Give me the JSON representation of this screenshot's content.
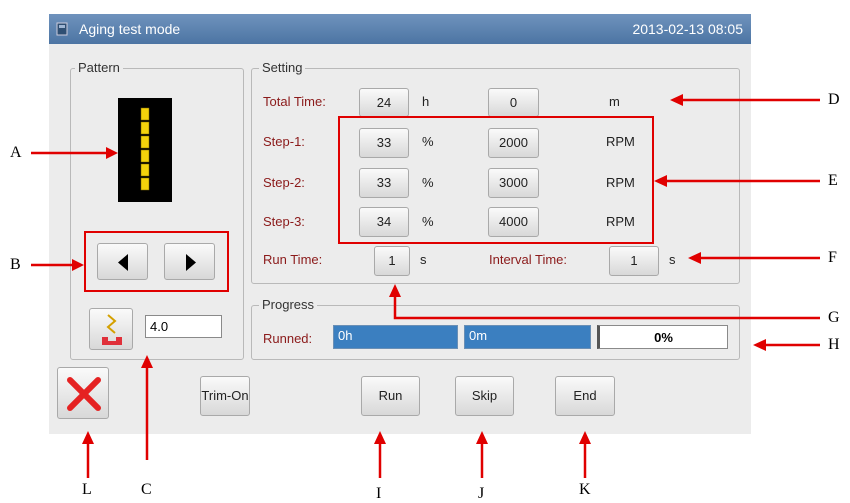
{
  "title_bar": {
    "title": "Aging test mode",
    "datetime": "2013-02-13  08:05"
  },
  "pattern": {
    "legend": "Pattern",
    "value": "4.0"
  },
  "setting": {
    "legend": "Setting",
    "total_time": {
      "label": "Total Time:",
      "hours": "24",
      "hours_unit": "h",
      "minutes": "0",
      "minutes_unit": "m"
    },
    "steps": [
      {
        "label": "Step-1:",
        "percent": "33",
        "percent_unit": "%",
        "rpm": "2000",
        "rpm_unit": "RPM"
      },
      {
        "label": "Step-2:",
        "percent": "33",
        "percent_unit": "%",
        "rpm": "3000",
        "rpm_unit": "RPM"
      },
      {
        "label": "Step-3:",
        "percent": "34",
        "percent_unit": "%",
        "rpm": "4000",
        "rpm_unit": "RPM"
      }
    ],
    "run_time": {
      "label": "Run Time:",
      "value": "1",
      "unit": "s"
    },
    "interval_time": {
      "label": "Interval Time:",
      "value": "1",
      "unit": "s"
    }
  },
  "progress": {
    "legend": "Progress",
    "label": "Runned:",
    "hours": "0h",
    "minutes": "0m",
    "percent": "0%",
    "fraction": 0
  },
  "buttons": {
    "trim": "Trim-On",
    "run": "Run",
    "skip": "Skip",
    "end": "End"
  },
  "callouts": [
    "A",
    "B",
    "C",
    "D",
    "E",
    "F",
    "G",
    "H",
    "I",
    "J",
    "K",
    "L"
  ],
  "colors": {
    "title_bar": "#5b80ad",
    "label_red": "#8b1a1a",
    "annotation_red": "#e00000",
    "progress_blue": "#3b7fc0"
  }
}
